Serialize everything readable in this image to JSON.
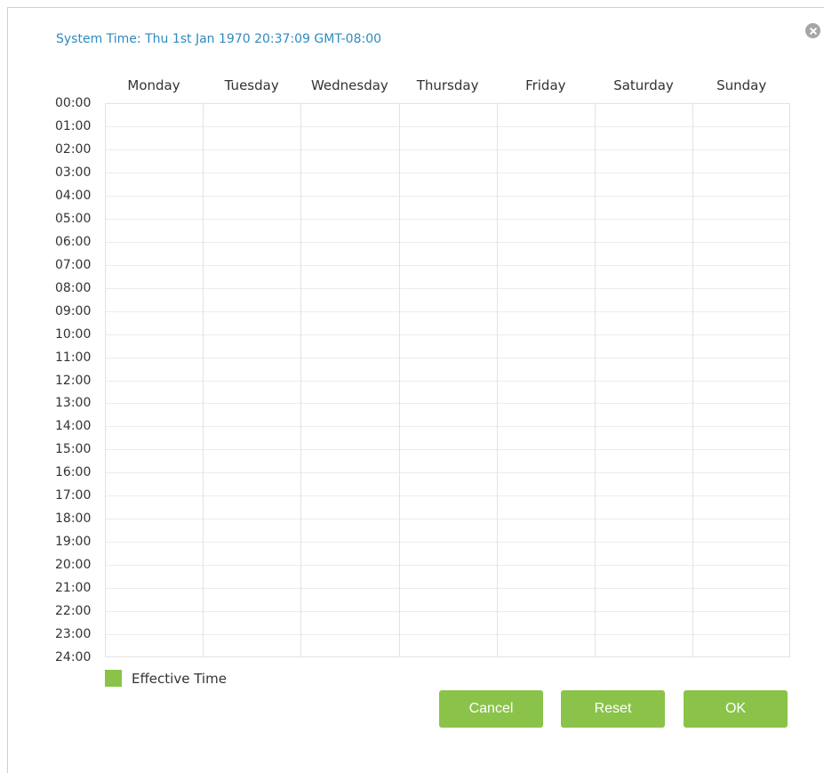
{
  "header": {
    "system_time": "System Time: Thu 1st Jan 1970 20:37:09 GMT-08:00"
  },
  "days": [
    "Monday",
    "Tuesday",
    "Wednesday",
    "Thursday",
    "Friday",
    "Saturday",
    "Sunday"
  ],
  "hours": [
    "00:00",
    "01:00",
    "02:00",
    "03:00",
    "04:00",
    "05:00",
    "06:00",
    "07:00",
    "08:00",
    "09:00",
    "10:00",
    "11:00",
    "12:00",
    "13:00",
    "14:00",
    "15:00",
    "16:00",
    "17:00",
    "18:00",
    "19:00",
    "20:00",
    "21:00",
    "22:00",
    "23:00",
    "24:00"
  ],
  "legend": {
    "label": "Effective Time",
    "color": "#8bc34a"
  },
  "buttons": {
    "cancel": "Cancel",
    "reset": "Reset",
    "ok": "OK",
    "color": "#8bc34a"
  },
  "icons": {
    "close": "close-icon"
  }
}
